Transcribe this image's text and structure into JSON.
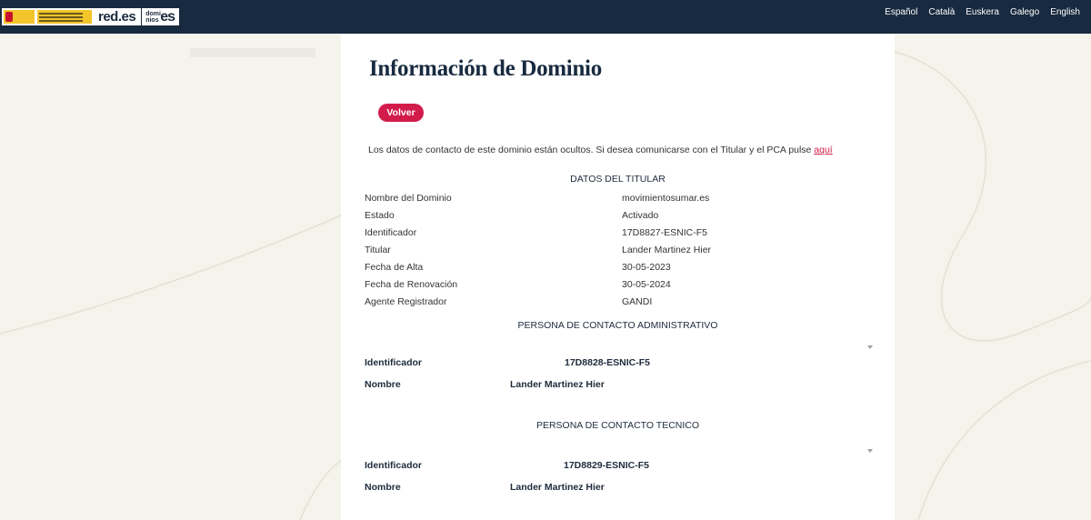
{
  "header": {
    "logo_text": "red.es",
    "dominios_small": "domi nios",
    "dominios_es": "es",
    "languages": [
      "Español",
      "Català",
      "Euskera",
      "Galego",
      "English"
    ]
  },
  "page": {
    "title": "Información de Dominio",
    "back_label": "Volver",
    "notice_text": "Los datos de contacto de este dominio están ocultos. Si desea comunicarse con el Titular y el PCA pulse ",
    "notice_link": "aquí"
  },
  "titular": {
    "heading": "DATOS DEL TITULAR",
    "rows": [
      {
        "label": "Nombre del Dominio",
        "value": "movimientosumar.es"
      },
      {
        "label": "Estado",
        "value": "Activado"
      },
      {
        "label": "Identificador",
        "value": "17D8827-ESNIC-F5"
      },
      {
        "label": "Titular",
        "value": "Lander Martinez Hier"
      },
      {
        "label": "Fecha de Alta",
        "value": "30-05-2023"
      },
      {
        "label": "Fecha de Renovación",
        "value": "30-05-2024"
      },
      {
        "label": "Agente Registrador",
        "value": "GANDI"
      }
    ]
  },
  "admin_contact": {
    "heading": "PERSONA DE CONTACTO ADMINISTRATIVO",
    "id_label": "Identificador",
    "id_value": "17D8828-ESNIC-F5",
    "name_label": "Nombre",
    "name_value": "Lander Martinez Hier"
  },
  "tech_contact": {
    "heading": "PERSONA DE CONTACTO TECNICO",
    "id_label": "Identificador",
    "id_value": "17D8829-ESNIC-F5",
    "name_label": "Nombre",
    "name_value": "Lander Martinez Hier"
  },
  "colors": {
    "header_bg": "#182a3f",
    "accent": "#d21c4b",
    "page_bg": "#f4f3ec"
  }
}
